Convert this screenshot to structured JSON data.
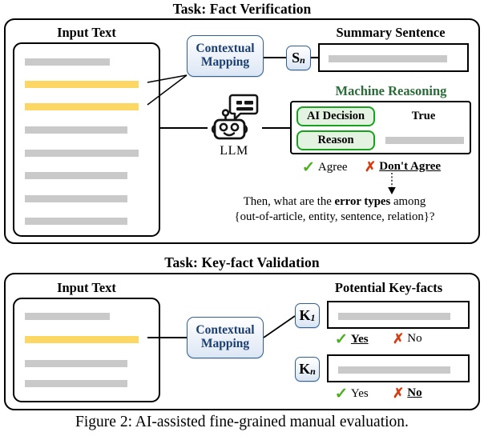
{
  "figure": {
    "caption": "Figure 2: AI-assisted fine-grained manual evaluation."
  },
  "tasks": [
    {
      "title": "Task: Fact Verification",
      "input_text": {
        "heading": "Input Text",
        "lines": [
          {
            "type": "gray",
            "width": 106
          },
          {
            "type": "yellow",
            "width": 142
          },
          {
            "type": "yellow",
            "width": 142
          },
          {
            "type": "gray",
            "width": 128
          },
          {
            "type": "gray",
            "width": 142
          },
          {
            "type": "gray",
            "width": 128
          },
          {
            "type": "gray",
            "width": 128
          },
          {
            "type": "gray",
            "width": 128
          }
        ]
      },
      "mapping_box": {
        "line1": "Contextual",
        "line2": "Mapping"
      },
      "sentence_badge": {
        "letter": "S",
        "subscript": "n"
      },
      "summary": {
        "heading": "Summary Sentence",
        "content_bar": "gray"
      },
      "machine_reasoning": {
        "heading": "Machine Reasoning",
        "rows": [
          {
            "chip": "AI Decision",
            "value": "True",
            "value_type": "text"
          },
          {
            "chip": "Reason",
            "value": "",
            "value_type": "gray-bar"
          }
        ]
      },
      "llm": {
        "label": "LLM",
        "icon": "robot-icon"
      },
      "choices": [
        {
          "icon": "check-icon",
          "label": "Agree",
          "emphasis": false
        },
        {
          "icon": "cross-icon",
          "label": "Don't Agree",
          "emphasis": true
        }
      ],
      "followup": {
        "line1_prefix": "Then, what are the ",
        "line1_bold": "error types",
        "line1_suffix": " among",
        "line2": "{out-of-article, entity, sentence, relation}?"
      }
    },
    {
      "title": "Task: Key-fact Validation",
      "input_text": {
        "heading": "Input Text",
        "lines": [
          {
            "type": "gray",
            "width": 106
          },
          {
            "type": "yellow",
            "width": 142
          },
          {
            "type": "gray",
            "width": 128
          },
          {
            "type": "gray",
            "width": 128
          }
        ]
      },
      "mapping_box": {
        "line1": "Contextual",
        "line2": "Mapping"
      },
      "keyfacts": {
        "heading": "Potential Key-facts",
        "items": [
          {
            "badge_letter": "K",
            "badge_subscript": "1",
            "content_bar": "gray",
            "choices": [
              {
                "icon": "check-icon",
                "label": "Yes",
                "emphasis": true
              },
              {
                "icon": "cross-icon",
                "label": "No",
                "emphasis": false
              }
            ]
          },
          {
            "badge_letter": "K",
            "badge_subscript": "n",
            "content_bar": "gray",
            "choices": [
              {
                "icon": "check-icon",
                "label": "Yes",
                "emphasis": false
              },
              {
                "icon": "cross-icon",
                "label": "No",
                "emphasis": true
              }
            ]
          }
        ]
      }
    }
  ],
  "colors": {
    "highlight_yellow": "#fcd764",
    "placeholder_gray": "#c9c9c9",
    "mapping_blue_border": "#2f6096",
    "mapping_blue_text": "#1c3f72",
    "reasoning_green_border": "#18a11c",
    "reasoning_green_fill": "#e4f3e1",
    "heading_green": "#2b6b38",
    "check_green": "#4caf1e",
    "cross_red": "#d93a10",
    "outline_black": "#000000"
  }
}
